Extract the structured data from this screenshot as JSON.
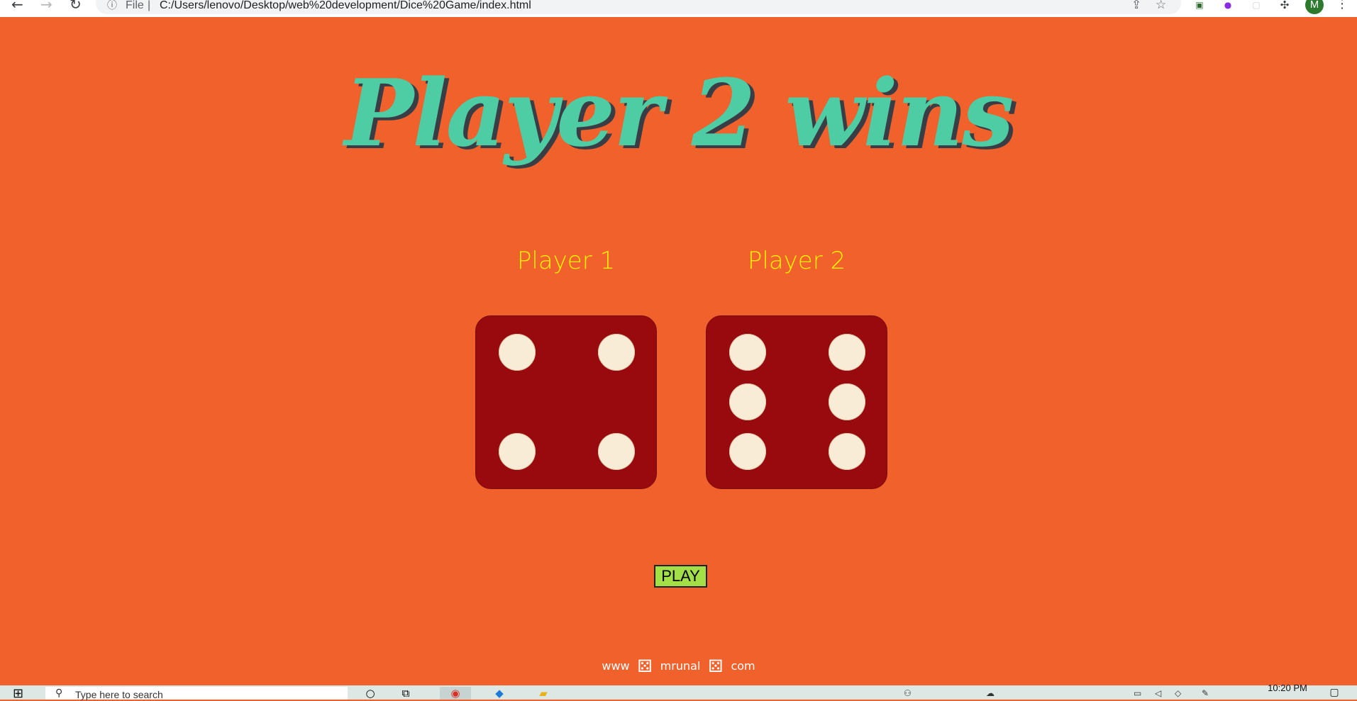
{
  "browser": {
    "url_scheme_label": "File",
    "url": "C:/Users/lenovo/Desktop/web%20development/Dice%20Game/index.html",
    "profile_initial": "M",
    "extensions": [
      "html-extension-icon",
      "purple-extension-icon",
      "blank-extension-icon",
      "puzzle-icon"
    ]
  },
  "page": {
    "heading": "Player 2 wins",
    "player1_label": "Player 1",
    "player2_label": "Player 2",
    "player1_dice_value": 4,
    "player2_dice_value": 6,
    "play_button": "PLAY",
    "footer": {
      "part1": "www",
      "part2": "mrunal",
      "part3": "com"
    }
  },
  "colors": {
    "background": "#f0612b",
    "heading": "#4ecca3",
    "heading_shadow": "#393e46",
    "player_label": "#fef200",
    "dice_face": "#990a0e",
    "dice_pip": "#f8ecd6",
    "play_button": "#a3e048"
  },
  "taskbar": {
    "search_placeholder": "Type here to search",
    "clock_time": "10:20 PM"
  }
}
